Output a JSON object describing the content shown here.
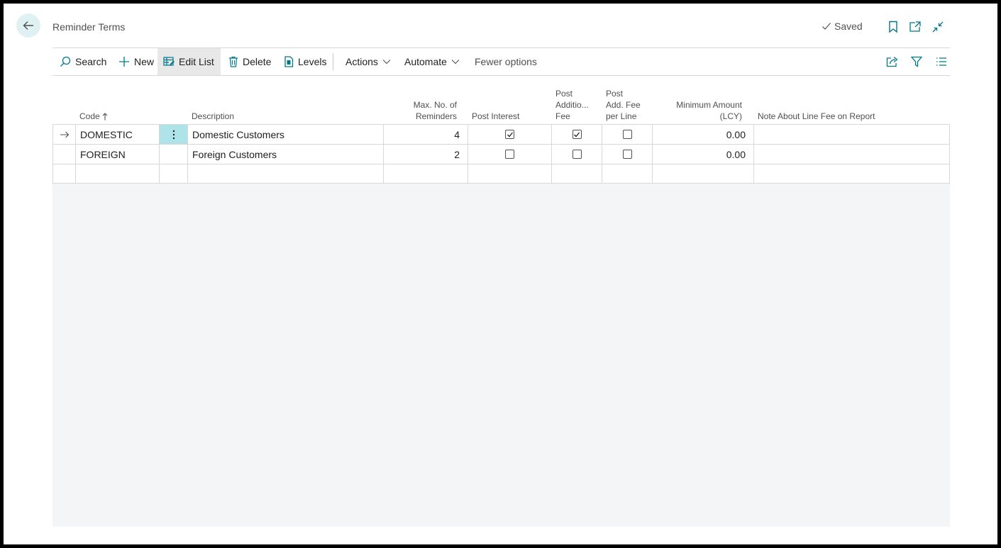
{
  "header": {
    "title": "Reminder Terms",
    "saved_label": "Saved"
  },
  "toolbar": {
    "search": "Search",
    "new": "New",
    "edit_list": "Edit List",
    "delete": "Delete",
    "levels": "Levels",
    "actions": "Actions",
    "automate": "Automate",
    "fewer_options": "Fewer options"
  },
  "columns": {
    "code": "Code",
    "description": "Description",
    "max_no_line1": "Max. No. of",
    "max_no_line2": "Reminders",
    "post_interest": "Post Interest",
    "post_addfee_line1": "Post",
    "post_addfee_line2": "Additio...",
    "post_addfee_line3": "Fee",
    "post_feeline_line1": "Post",
    "post_feeline_line2": "Add. Fee",
    "post_feeline_line3": "per Line",
    "min_amount_line1": "Minimum Amount",
    "min_amount_line2": "(LCY)",
    "note": "Note About Line Fee on Report"
  },
  "rows": [
    {
      "code": "DOMESTIC",
      "description": "Domestic Customers",
      "max_reminders": "4",
      "post_interest": true,
      "post_additional_fee": true,
      "post_add_fee_per_line": false,
      "min_amount": "0.00",
      "note": ""
    },
    {
      "code": "FOREIGN",
      "description": "Foreign Customers",
      "max_reminders": "2",
      "post_interest": false,
      "post_additional_fee": false,
      "post_add_fee_per_line": false,
      "min_amount": "0.00",
      "note": ""
    }
  ],
  "colors": {
    "accent": "#00788a",
    "selected_cell": "#aee3e9",
    "back_button_bg": "#dff1f3"
  }
}
